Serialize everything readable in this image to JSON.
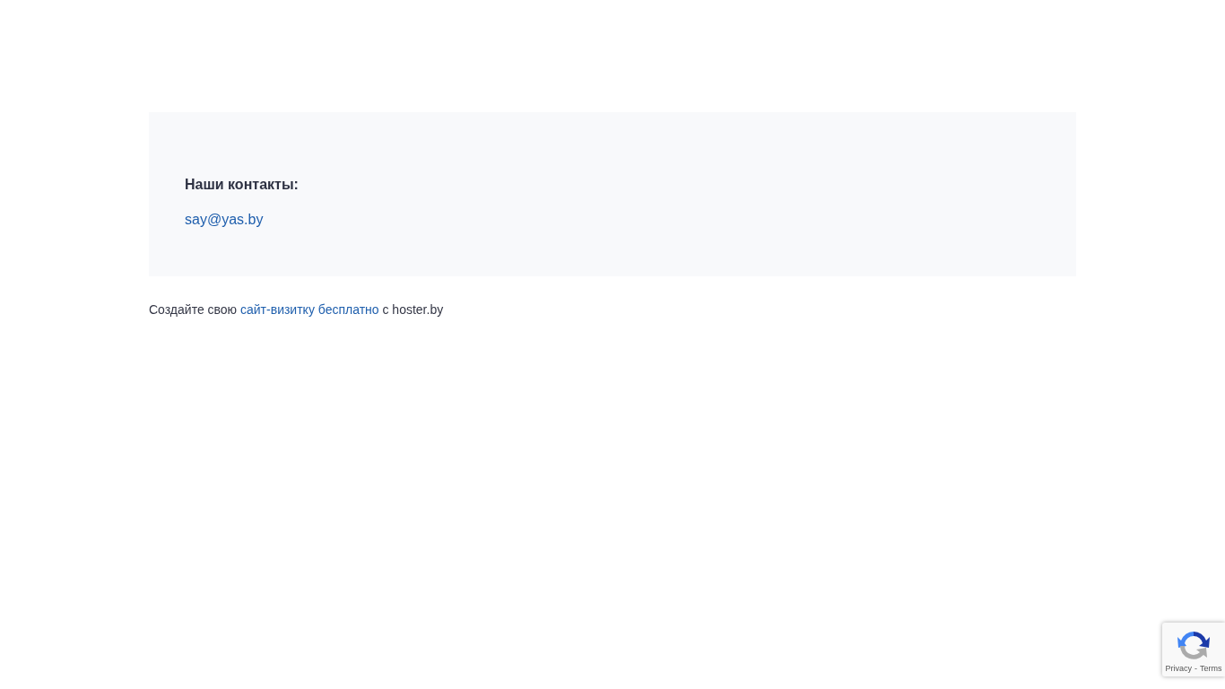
{
  "contacts": {
    "heading": "Наши контакты:",
    "email": "say@yas.by"
  },
  "footer": {
    "before": "Создайте свою ",
    "link": "сайт-визитку бесплатно",
    "after": " с hoster.by"
  },
  "recaptcha_badge": {
    "privacy": "Privacy",
    "separator": "-",
    "terms": "Terms"
  }
}
